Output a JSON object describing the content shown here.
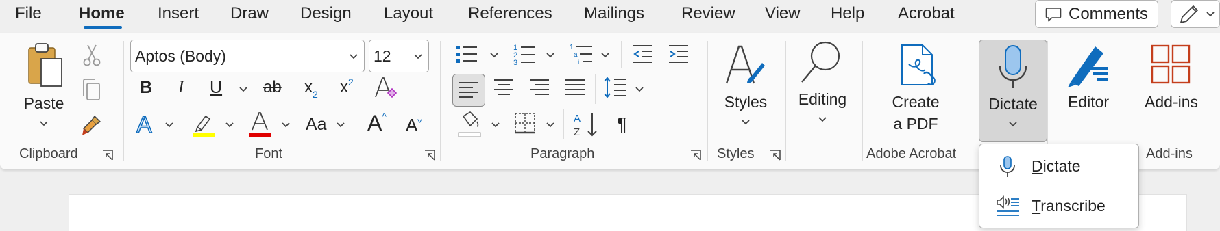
{
  "menu": {
    "tabs": [
      "File",
      "Home",
      "Insert",
      "Draw",
      "Design",
      "Layout",
      "References",
      "Mailings",
      "Review",
      "View",
      "Help",
      "Acrobat"
    ],
    "active_tab": "Home",
    "comments_label": "Comments"
  },
  "clipboard": {
    "paste_label": "Paste",
    "group_label": "Clipboard"
  },
  "font": {
    "font_name": "Aptos (Body)",
    "font_size": "12",
    "group_label": "Font",
    "bold": "B",
    "italic": "I",
    "underline": "U",
    "strikethrough": "ab",
    "subscript": "x",
    "subscript_mark": "2",
    "superscript": "x",
    "superscript_mark": "2",
    "grow": "A",
    "shrink": "A",
    "change_case": "Aa",
    "highlight_color": "#ffff00",
    "font_color": "#e00000"
  },
  "paragraph": {
    "group_label": "Paragraph",
    "pilcrow": "¶"
  },
  "styles": {
    "button_label": "Styles",
    "group_label": "Styles"
  },
  "editing": {
    "button_label": "Editing"
  },
  "acrobat": {
    "create_line1": "Create",
    "create_line2": "a PDF",
    "group_label": "Adobe Acrobat"
  },
  "voice": {
    "dictate_label": "Dictate"
  },
  "editor": {
    "button_label": "Editor"
  },
  "addins": {
    "button_label": "Add-ins",
    "group_label": "Add-ins"
  },
  "dictate_menu": {
    "items": [
      {
        "first": "D",
        "rest": "ictate"
      },
      {
        "first": "T",
        "rest": "ranscribe"
      }
    ]
  },
  "colors": {
    "accent": "#0f6cbd",
    "red_accent": "#c43e1c"
  }
}
